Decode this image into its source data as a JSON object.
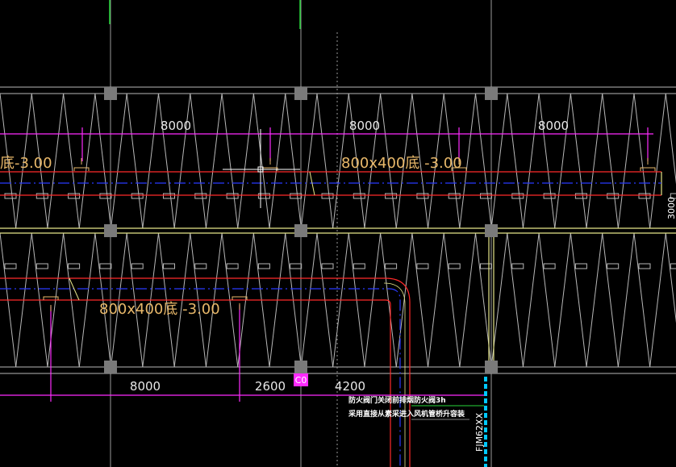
{
  "colors": {
    "background": "#000000",
    "grid": "#b8b8b8",
    "dimension_line": "#ff2bff",
    "duct_outline": "#ff2a2a",
    "duct_centerline": "#2a3aff",
    "duct_label": "#e8b86a",
    "beam": "#e6e68a",
    "axis_green": "#27d63a",
    "column": "#7a7a7a",
    "cyan_line": "#00c8ff",
    "dimension_text": "#e8e8e8"
  },
  "top_dimensions": [
    "8000",
    "8000",
    "8000"
  ],
  "bottom_dimensions": [
    "8000",
    "2600",
    "4200"
  ],
  "duct_labels": {
    "top_left_partial": "底-3.00",
    "top_right": "800x400底 -3.00",
    "bottom": "800x400底 -3.00"
  },
  "marker_code": "C0",
  "notes": {
    "line1": "防火阀门关闭前排烟防火阀⁥3h",
    "line2": "采用直接从素采进入风机管桥升容装"
  },
  "equipment_tag": "FJM62XX",
  "edge_text_right": "3000",
  "cursor": {
    "type": "crosshair"
  }
}
